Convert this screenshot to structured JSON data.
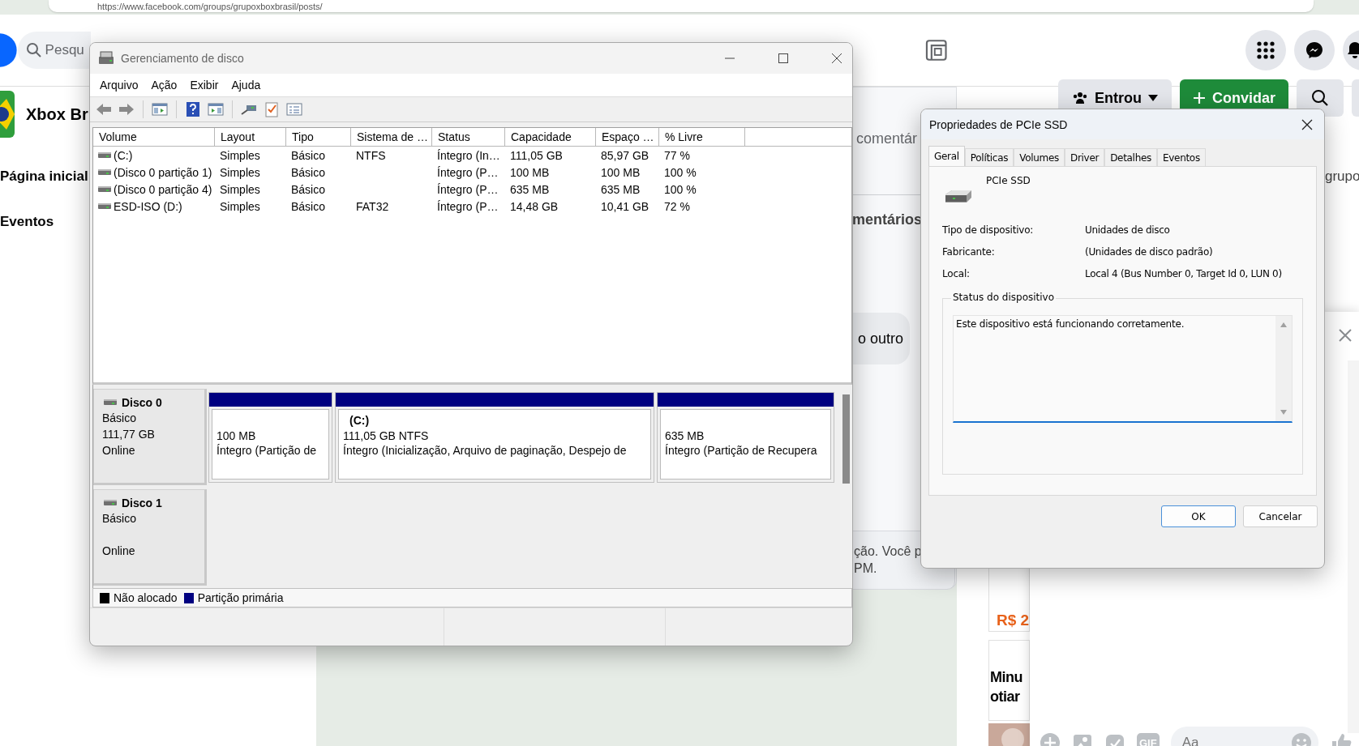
{
  "browser": {
    "url": "https://www.facebook.com/groups/grupoxboxbrasil/posts/"
  },
  "facebook": {
    "search": {
      "placeholder": "Pesqu"
    },
    "group_name": "Xbox Br",
    "sidebar_items": [
      "Página inicial",
      "Eventos"
    ],
    "header_buttons": [
      {
        "label": "Entrou",
        "kind": "secondary"
      },
      {
        "label": "Convidar",
        "kind": "primary"
      }
    ],
    "feed_fragments": {
      "comments_a": "comentár",
      "comments_b": "mentários",
      "reply": "o outro",
      "notice_1": "ção. Você p",
      "notice_2": "PM.",
      "group_word": "grupo"
    },
    "ads": [
      {
        "price": "R$ 2"
      },
      {
        "line_1": "Minu",
        "line_2": "otiar"
      }
    ],
    "chat": {
      "placeholder": "Aa",
      "gif_label": "GIF"
    }
  },
  "disk_management": {
    "title": "Gerenciamento de disco",
    "menu": [
      "Arquivo",
      "Ação",
      "Exibir",
      "Ajuda"
    ],
    "columns": [
      "Volume",
      "Layout",
      "Tipo",
      "Sistema de …",
      "Status",
      "Capacidade",
      "Espaço …",
      "% Livre"
    ],
    "rows": [
      {
        "volume": " (C:)",
        "layout": "Simples",
        "type": "Básico",
        "file_system": "NTFS",
        "status": "Íntegro (In…",
        "capacity": "111,05 GB",
        "free_space": "85,97 GB",
        "percent_free": "77 %"
      },
      {
        "volume": "(Disco 0 partição 1)",
        "layout": "Simples",
        "type": "Básico",
        "file_system": "",
        "status": "Íntegro (P…",
        "capacity": "100 MB",
        "free_space": "100 MB",
        "percent_free": "100 %"
      },
      {
        "volume": "(Disco 0 partição 4)",
        "layout": "Simples",
        "type": "Básico",
        "file_system": "",
        "status": "Íntegro (P…",
        "capacity": "635 MB",
        "free_space": "635 MB",
        "percent_free": "100 %"
      },
      {
        "volume": "ESD-ISO (D:)",
        "layout": "Simples",
        "type": "Básico",
        "file_system": "FAT32",
        "status": "Íntegro (P…",
        "capacity": "14,48 GB",
        "free_space": "10,41 GB",
        "percent_free": "72 %"
      }
    ],
    "disks": [
      {
        "name": "Disco 0",
        "type": "Básico",
        "size": "111,77 GB",
        "status": "Online",
        "partitions": [
          {
            "size": "100 MB",
            "status": "Íntegro (Partição de"
          },
          {
            "label": "(C:)",
            "size": "111,05 GB NTFS",
            "status": "Íntegro (Inicialização, Arquivo de paginação, Despejo de"
          },
          {
            "size": "635 MB",
            "status": "Íntegro (Partição de Recupera"
          }
        ]
      },
      {
        "name": "Disco 1",
        "type": "Básico",
        "status": "Online"
      }
    ],
    "legend": [
      {
        "label": "Não alocado",
        "color": "#000000"
      },
      {
        "label": "Partição primária",
        "color": "#000080"
      }
    ]
  },
  "properties": {
    "title": "Propriedades de PCIe SSD",
    "tabs": [
      {
        "label": "Geral",
        "selected": true
      },
      {
        "label": "Políticas",
        "selected": false
      },
      {
        "label": "Volumes",
        "selected": false
      },
      {
        "label": "Driver",
        "selected": false
      },
      {
        "label": "Detalhes",
        "selected": false
      },
      {
        "label": "Eventos",
        "selected": false
      }
    ],
    "device_name": "PCIe SSD",
    "fields": [
      {
        "label": "Tipo de dispositivo:",
        "value": "Unidades de disco"
      },
      {
        "label": "Fabricante:",
        "value": "(Unidades de disco padrão)"
      },
      {
        "label": "Local:",
        "value": "Local 4 (Bus Number 0, Target Id 0, LUN 0)"
      }
    ],
    "status_group": "Status do dispositivo",
    "status_text": "Este dispositivo está funcionando corretamente.",
    "buttons": [
      {
        "label": "OK",
        "default": true
      },
      {
        "label": "Cancelar",
        "default": false
      }
    ]
  }
}
